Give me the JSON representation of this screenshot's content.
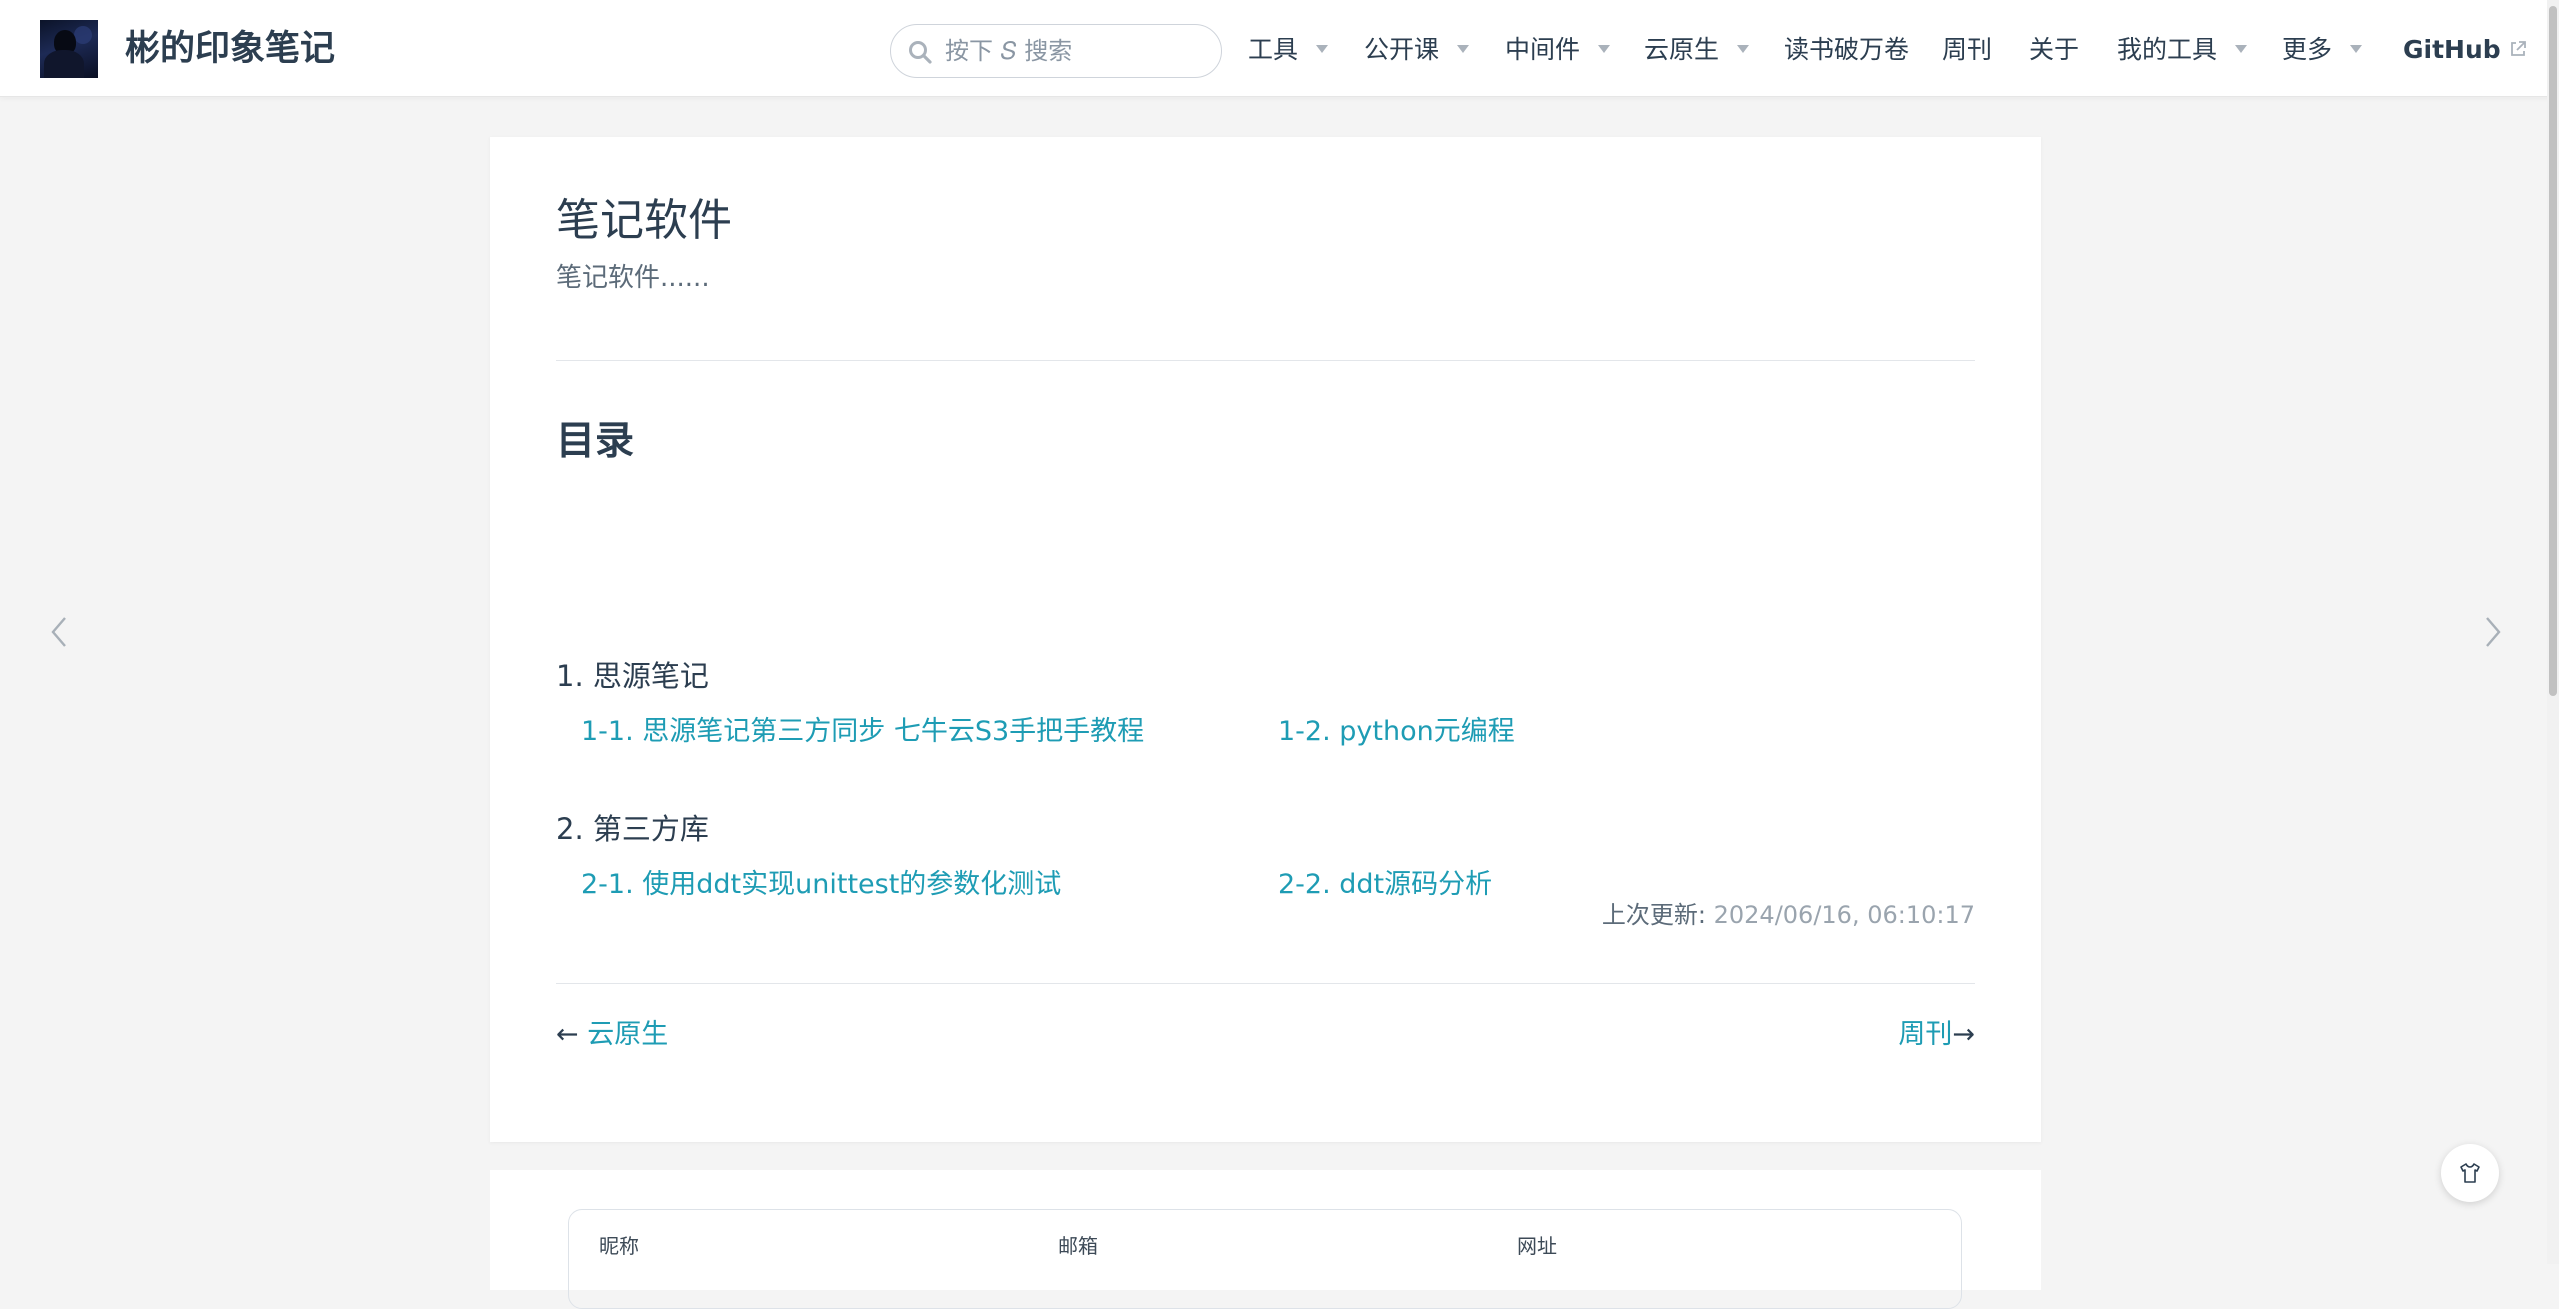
{
  "header": {
    "site_name": "彬的印象笔记",
    "search": {
      "placeholder": "按下 𝑆 搜索",
      "value": ""
    },
    "nav": [
      {
        "label": "工具",
        "has_dropdown": true
      },
      {
        "label": "公开课",
        "has_dropdown": true
      },
      {
        "label": "中间件",
        "has_dropdown": true
      },
      {
        "label": "云原生",
        "has_dropdown": true
      },
      {
        "label": "读书破万卷",
        "has_dropdown": false
      },
      {
        "label": "周刊",
        "has_dropdown": false
      },
      {
        "label": "关于",
        "has_dropdown": false
      },
      {
        "label": "我的工具",
        "has_dropdown": true
      },
      {
        "label": "更多",
        "has_dropdown": true
      },
      {
        "label": "GitHub",
        "has_dropdown": false,
        "external": true
      }
    ]
  },
  "page": {
    "title": "笔记软件",
    "description": "笔记软件......",
    "toc": {
      "heading": "目录",
      "sections": [
        {
          "title": "1. 思源笔记",
          "links": [
            "1-1. 思源笔记第三方同步 七牛云S3手把手教程",
            "1-2. python元编程"
          ]
        },
        {
          "title": "2. 第三方库",
          "links": [
            "2-1. 使用ddt实现unittest的参数化测试",
            "2-2. ddt源码分析"
          ]
        }
      ]
    },
    "last_updated": {
      "label": "上次更新:",
      "value": "2024/06/16, 06:10:17"
    },
    "prev": {
      "arrow": "←",
      "label": "云原生"
    },
    "next": {
      "arrow": "→",
      "label": "周刊"
    }
  },
  "comments": {
    "fields": [
      "昵称",
      "邮箱",
      "网址"
    ]
  },
  "colors": {
    "link": "#1e9cb4",
    "text": "#2c3e50",
    "background": "#f4f4f4"
  },
  "icons": {
    "search": "search-icon",
    "external": "external-link-icon",
    "prev_page": "chevron-left-icon",
    "next_page": "chevron-right-icon",
    "theme": "shirt-icon"
  }
}
